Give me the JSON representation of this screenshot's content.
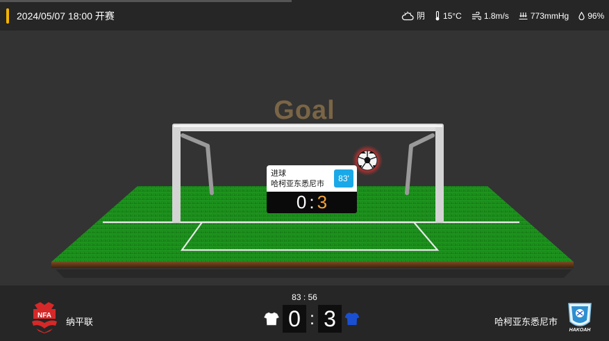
{
  "header": {
    "match_start": "2024/05/07 18:00 开赛",
    "weather": {
      "condition": "阴",
      "temperature": "15°C",
      "wind": "1.8m/s",
      "pressure": "773mmHg",
      "humidity": "96%"
    },
    "colors": {
      "accent": "#f5b400",
      "bar": "#262626"
    }
  },
  "stage": {
    "title": "Goal",
    "event": {
      "label": "进球",
      "team": "哈柯亚东悉尼市",
      "minute": "83'",
      "score_home": "0",
      "score_separator": ":",
      "score_away": "3"
    },
    "icons": [
      "soccer-ball-icon",
      "goal-net-icon"
    ],
    "colors": {
      "title": "#7a6546",
      "minute_badge": "#1aa8e8",
      "away_score": "#f4a23a",
      "pitch": "#1a8a1a"
    }
  },
  "scoreboard": {
    "clock": "83 : 56",
    "home": {
      "name": "纳平联",
      "logo_text": "NFA",
      "score": "0",
      "shirt_color": "#ffffff"
    },
    "separator": ":",
    "away": {
      "name": "哈柯亚东悉尼市",
      "logo_text": "HAKOAH",
      "score": "3",
      "shirt_color": "#1a4fd1"
    }
  }
}
